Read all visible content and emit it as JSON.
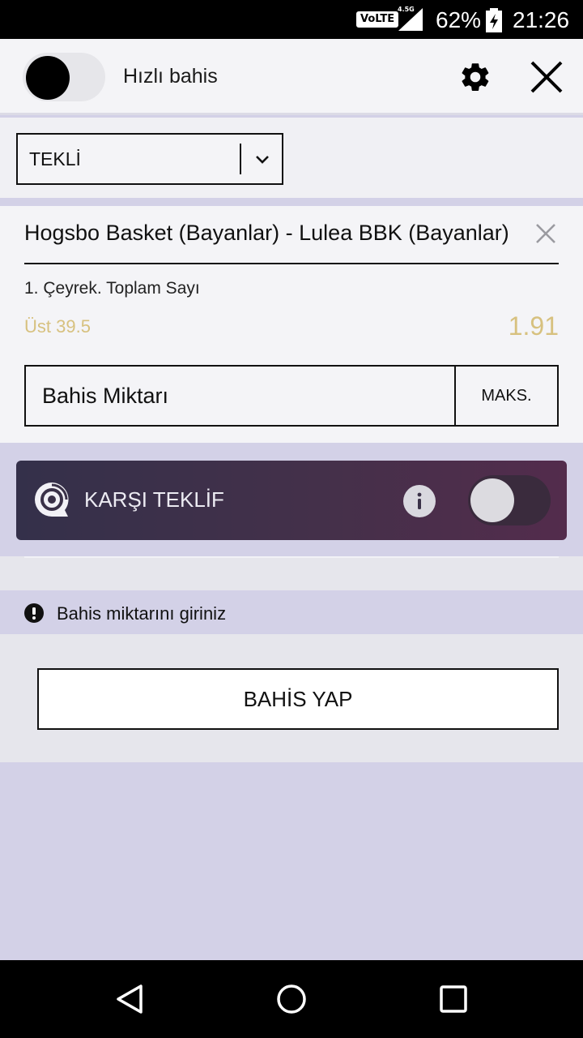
{
  "status_bar": {
    "volte": "VoLTE",
    "network": "4.5G",
    "battery": "62%",
    "time": "21:26"
  },
  "header": {
    "quick_bet_label": "Hızlı bahis",
    "quick_bet_on": false
  },
  "bet_type": {
    "selected": "TEKLİ"
  },
  "bet": {
    "match": "Hogsbo Basket (Bayanlar) - Lulea BBK (Bayanlar)",
    "market": "1. Çeyrek. Toplam Sayı",
    "selection": "Üst 39.5",
    "odds": "1.91",
    "stake_placeholder": "Bahis Miktarı",
    "max_label": "MAKS."
  },
  "counter_offer": {
    "label": "KARŞI TEKLİF",
    "enabled": false
  },
  "warning": {
    "text": "Bahis miktarını giriniz"
  },
  "place_bet": {
    "label": "BAHİS YAP"
  },
  "colors": {
    "accent_gold": "#d7c17f",
    "lavender": "#d3d1e7",
    "counter_offer_start": "#34304a",
    "counter_offer_end": "#532c4c"
  }
}
